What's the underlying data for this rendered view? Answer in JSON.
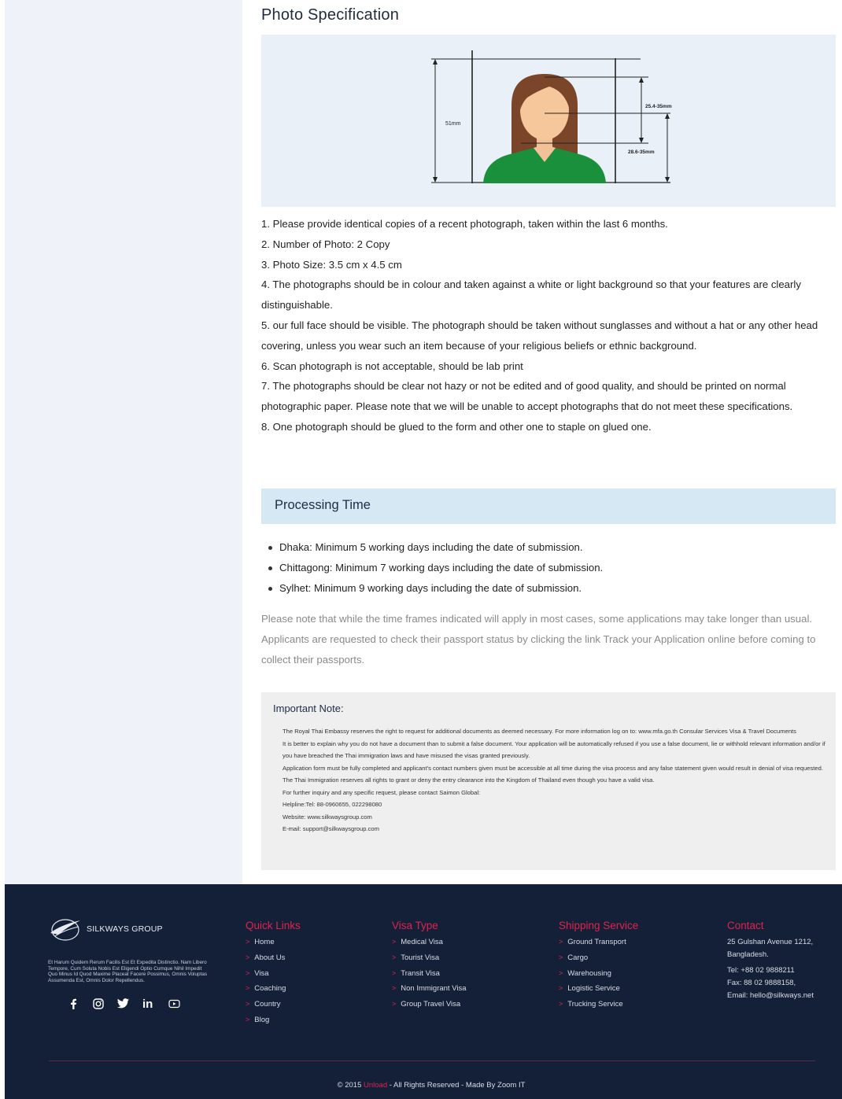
{
  "photo_section": {
    "title": "Photo Specification",
    "diagram_labels": {
      "height": "51mm",
      "face": "25.4-35mm",
      "eye": "28.6-35mm"
    },
    "items": [
      "1. Please provide identical copies of a recent photograph, taken within the last 6 months.",
      "2. Number of Photo: 2 Copy",
      "3. Photo Size: 3.5 cm x 4.5 cm",
      "4. The photographs should be in colour and taken against a white or light background so that your features are clearly distinguishable.",
      "5. our full face should be visible. The photograph should be taken without sunglasses and without a hat or any other head covering, unless you wear such an item because of your religious beliefs or ethnic background.",
      "6. Scan photograph is not acceptable, should be lab print",
      "7. The photographs should be clear not hazy or not be edited and of good quality, and should be printed on normal photographic paper. Please note that we will be unable to accept photographs that do not meet these specifications.",
      "8. One photograph should be glued to the form and other one to staple on glued one."
    ]
  },
  "processing": {
    "title": "Processing Time",
    "items": [
      "Dhaka: Minimum 5 working days including the date of submission.",
      "Chittagong: Minimum 7 working days including the date of submission.",
      "Sylhet: Minimum 9 working days including the date of submission."
    ],
    "note": "Please note that while the time frames indicated will apply in most cases, some applications may take longer than usual. Applicants are requested to check their passport status by clicking the link Track your Application online before coming to collect their passports."
  },
  "important": {
    "title": "Important Note:",
    "lines": [
      "The Royal Thai Embassy reserves the right to request for additional documents as deemed necessary. For more information log on to: www.mfa.go.th Consular Services Visa & Travel Documents",
      "It is better to explain why you do not have a document than to submit a false document. Your application will be automatically refused if you use a false document, lie or withhold relevant information and/or if you have breached the Thai immigration laws and have misused the visas granted previously.",
      "Application form must be fully completed and applicant's contact numbers given must be accessible at all time during the visa process and any false statement given would result in denial of visa requested.",
      "The Thai Immigration reserves all rights to grant or deny the entry clearance into the Kingdom of Thailand even though you have a valid visa.",
      "For further inquiry and any specific request, please contact Saimon Global:",
      "Helpline:Tel: 88-0960655, 022298080",
      "Website: www.silkwaysgroup.com",
      "E-mail: support@silkwaysgroup.com"
    ]
  },
  "footer": {
    "brand": "SILKWAYS GROUP",
    "description": "Et Harum Quidem Rerum Facilis Est Et Expedita Distinctio. Nam Libero Tempore, Cum Soluta Nobis Est Eligendi Optio Cumque Nihil Impedit Quo Minus Id Quod Maxime Placeat Facere Possimus, Omnis Voluptas Assumenda Est, Omnis Dolor Repellendus.",
    "social_icons": [
      "facebook-icon",
      "instagram-icon",
      "twitter-icon",
      "linkedin-icon",
      "youtube-icon"
    ],
    "quick_links": {
      "title": "Quick Links",
      "items": [
        "Home",
        "About Us",
        "Visa",
        "Coaching",
        "Country",
        "Blog"
      ]
    },
    "visa_type": {
      "title": "Visa Type",
      "items": [
        "Medical Visa",
        "Tourist Visa",
        "Transit Visa",
        "Non Immigrant Visa",
        "Group Travel Visa"
      ]
    },
    "shipping": {
      "title": "Shipping Service",
      "items": [
        "Ground Transport",
        "Cargo",
        "Warehousing",
        "Logistic Service",
        "Trucking Service"
      ]
    },
    "contact": {
      "title": "Contact",
      "address_line1": "25 Gulshan Avenue 1212,",
      "address_line2": "Bangladesh.",
      "tel": "Tel: +88 02 9888211",
      "fax": "Fax: 88 02 9888158,",
      "email": "Email: hello@silkways.net"
    },
    "copyright": {
      "prefix": "© 2015 ",
      "brand": "Unload",
      "suffix": " - All Rights Reserved - Made By Zoom IT"
    }
  },
  "colors": {
    "accent": "#e0224e",
    "footer_bg": "#142038",
    "suit": "#1a8f3c"
  }
}
